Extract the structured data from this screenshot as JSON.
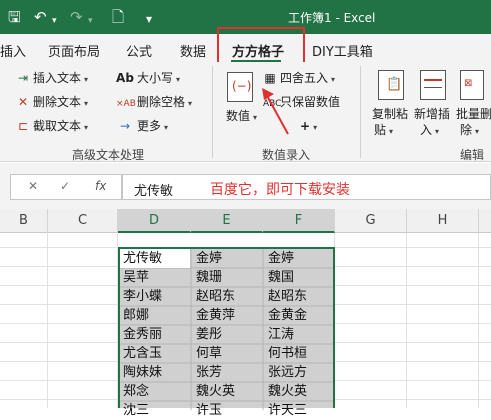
{
  "window": {
    "title": "工作簿1 - Excel"
  },
  "tabs": [
    {
      "label": "插入",
      "active": false
    },
    {
      "label": "页面布局",
      "active": false
    },
    {
      "label": "公式",
      "active": false
    },
    {
      "label": "数据",
      "active": false
    },
    {
      "label": "方方格子",
      "active": true
    },
    {
      "label": "DIY工具箱",
      "active": false
    }
  ],
  "ribbon": {
    "text_group": {
      "insert_text": "插入文本",
      "delete_text": "删除文本",
      "cut_text": "截取文本",
      "case": "大小写",
      "delete_space": "删除空格",
      "more": "更多",
      "label": "高级文本处理"
    },
    "numeric_group": {
      "value": "数值",
      "round": "四舍五入",
      "keep_value": "只保留数值",
      "plus": "+",
      "label": "数值录入"
    },
    "edit_group": {
      "copy_paste_1": "复制粘",
      "copy_paste_2": "贴",
      "new_insert_1": "新增插",
      "new_insert_2": "入",
      "batch_delete_1": "批量删",
      "batch_delete_2": "除",
      "label": "编辑"
    }
  },
  "formula_bar": {
    "cancel": "✕",
    "confirm": "✓",
    "fx": "fx",
    "value": "尤传敏"
  },
  "annotation": "百度它，即可下载安装",
  "columns": [
    "B",
    "C",
    "D",
    "E",
    "F",
    "G",
    "H"
  ],
  "rows": [
    [
      "尤传敏",
      "金婷",
      "金婷"
    ],
    [
      "吴苹",
      "魏珊",
      "魏国"
    ],
    [
      "李小蝶",
      "赵昭东",
      "赵昭东"
    ],
    [
      "郎娜",
      "金黄萍",
      "金黄金"
    ],
    [
      "金秀丽",
      "姜彤",
      "江涛"
    ],
    [
      "尤含玉",
      "何草",
      "何书桓"
    ],
    [
      "陶妹妹",
      "张芳",
      "张远方"
    ],
    [
      "郑念",
      "魏火英",
      "魏火英"
    ],
    [
      "沈三",
      "许玉",
      "许天三"
    ]
  ],
  "colors": {
    "accent": "#217346",
    "highlight": "#e0312f"
  }
}
